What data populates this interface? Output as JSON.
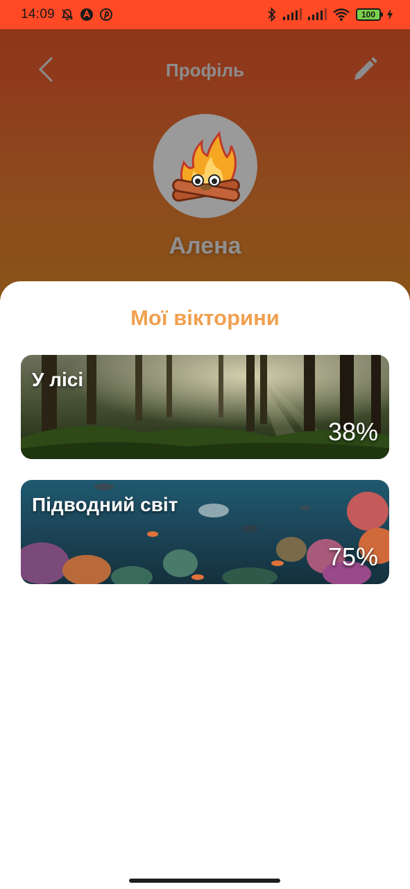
{
  "status_bar": {
    "time": "14:09",
    "battery": "100",
    "icons": [
      "bell-off-icon",
      "app-a-icon",
      "pinterest-icon",
      "bluetooth-icon",
      "signal-icon",
      "signal-icon",
      "wifi-icon",
      "battery-icon",
      "charging-icon"
    ]
  },
  "header": {
    "title": "Профіль",
    "back_icon": "chevron-left-icon",
    "edit_icon": "pencil-icon"
  },
  "profile": {
    "name": "Алена",
    "avatar": "campfire-mascot"
  },
  "quizzes": {
    "title": "Мої вікторини",
    "items": [
      {
        "title": "У лісі",
        "progress": "38%",
        "theme": "forest"
      },
      {
        "title": "Підводний світ",
        "progress": "75%",
        "theme": "underwater"
      }
    ]
  },
  "colors": {
    "status_bar": "#ff4a25",
    "header_top": "#8e3418",
    "header_bottom": "#8a5418",
    "accent": "#f0a050",
    "sheet": "#ffffff"
  }
}
